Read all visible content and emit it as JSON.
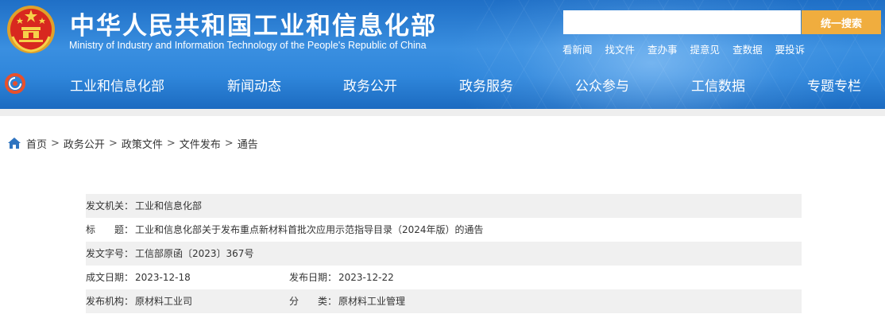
{
  "header": {
    "title": "中华人民共和国工业和信息化部",
    "subtitle": "Ministry of Industry and Information Technology of the People's Republic of China",
    "search": {
      "placeholder": "",
      "button_label": "统一搜索"
    },
    "quick_links": [
      "看新闻",
      "找文件",
      "查办事",
      "提意见",
      "查数据",
      "要投诉"
    ],
    "colors": {
      "header_blue": "#2f86db",
      "search_button": "#f0ad3e"
    }
  },
  "nav": {
    "items": [
      "工业和信息化部",
      "新闻动态",
      "政务公开",
      "政务服务",
      "公众参与",
      "工信数据",
      "专题专栏"
    ]
  },
  "breadcrumb": {
    "items": [
      "首页",
      "政务公开",
      "政策文件",
      "文件发布",
      "通告"
    ],
    "separator": ">"
  },
  "document_info": {
    "issuer_label": "发文机关：",
    "issuer": "工业和信息化部",
    "title_label_1": "标",
    "title_label_2": "题：",
    "title": "工业和信息化部关于发布重点新材料首批次应用示范指导目录（2024年版）的通告",
    "doc_number_label": "发文字号：",
    "doc_number": "工信部原函〔2023〕367号",
    "created_label": "成文日期：",
    "created": "2023-12-18",
    "published_label": "发布日期：",
    "published": "2023-12-22",
    "agency_label": "发布机构：",
    "agency": "原材料工业司",
    "category_label_1": "分",
    "category_label_2": "类：",
    "category": "原材料工业管理"
  }
}
